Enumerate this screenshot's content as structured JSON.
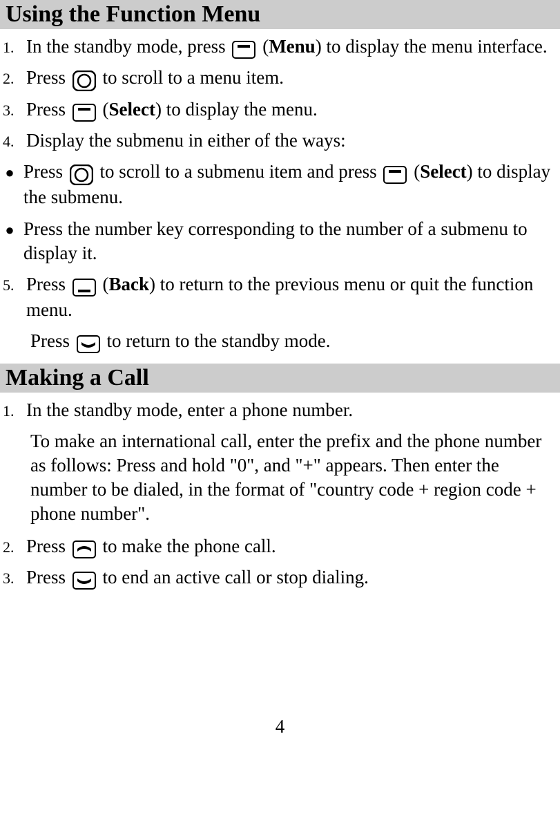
{
  "section1": {
    "heading": "Using the Function Menu",
    "steps": [
      {
        "num": "1.",
        "pre": "In the standby mode, press ",
        "icon": "dash",
        "mid": " (",
        "label": "Menu",
        "post": ") to display the menu interface."
      },
      {
        "num": "2.",
        "pre": "Press ",
        "icon": "ring",
        "post": " to scroll to a menu item."
      },
      {
        "num": "3.",
        "pre": "Press ",
        "icon": "dash",
        "mid": " (",
        "label": "Select",
        "post": ") to display the menu."
      },
      {
        "num": "4.",
        "text": "Display the submenu in either of the ways:"
      }
    ],
    "bullets": [
      {
        "pre": "Press ",
        "icon1": "ring",
        "mid1": " to scroll to a submenu item and press ",
        "icon2": "dash",
        "mid2": " (",
        "label": "Select",
        "post": ") to display the submenu."
      },
      {
        "text": "Press the number key corresponding to the number of a submenu to display it."
      }
    ],
    "step5": {
      "num": "5.",
      "pre": "Press ",
      "icon": "dashflip",
      "mid": " (",
      "label": "Back",
      "post": ") to return to the previous menu or quit the function menu."
    },
    "tail": {
      "pre": "Press ",
      "icon": "phone-down",
      "post": " to return to the standby mode."
    }
  },
  "section2": {
    "heading": "Making a Call",
    "step1": {
      "num": "1.",
      "text": "In the standby mode, enter a phone number."
    },
    "para": "To make an international call, enter the prefix and the phone number as follows: Press and hold \"0\", and \"+\" appears. Then enter the number to be dialed, in the format of \"country code + region code + phone number\".",
    "step2": {
      "num": "2.",
      "pre": "Press ",
      "icon": "phone-up",
      "post": " to make the phone call."
    },
    "step3": {
      "num": "3.",
      "pre": "Press ",
      "icon": "phone-down",
      "post": " to end an active call or stop dialing."
    }
  },
  "page_number": "4",
  "bullet_char": "●"
}
